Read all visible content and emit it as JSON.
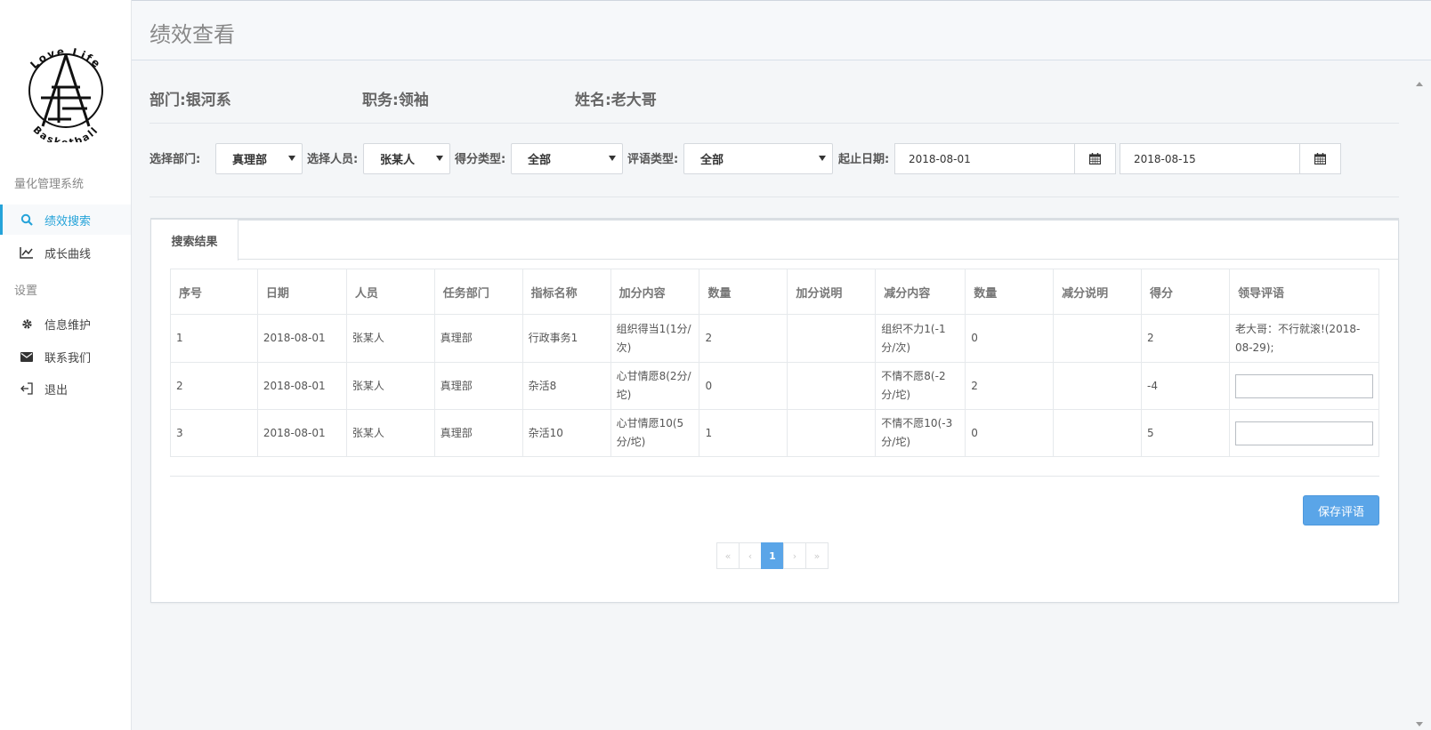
{
  "logo": {
    "top_text": "Love Life",
    "bottom_text": "Basketball"
  },
  "sidebar": {
    "section1": "量化管理系统",
    "items1": [
      {
        "label": "绩效搜索",
        "icon": "search-icon",
        "active": true
      },
      {
        "label": "成长曲线",
        "icon": "line-chart-icon"
      }
    ],
    "section2": "设置",
    "items2": [
      {
        "label": "信息维护",
        "icon": "gear-icon"
      },
      {
        "label": "联系我们",
        "icon": "envelope-icon"
      },
      {
        "label": "退出",
        "icon": "sign-out-icon"
      }
    ]
  },
  "header": {
    "title": "绩效查看"
  },
  "info": {
    "department": "部门:银河系",
    "position": "职务:领袖",
    "name": "姓名:老大哥"
  },
  "filters": {
    "dept_label": "选择部门:",
    "dept_value": "真理部",
    "person_label": "选择人员:",
    "person_value": "张某人",
    "score_type_label": "得分类型:",
    "score_type_value": "全部",
    "comment_type_label": "评语类型:",
    "comment_type_value": "全部",
    "date_label": "起止日期:",
    "start_date": "2018-08-01",
    "end_date": "2018-08-15"
  },
  "panel": {
    "tab": "搜索结果",
    "save_button": "保存评语"
  },
  "table": {
    "headers": [
      "序号",
      "日期",
      "人员",
      "任务部门",
      "指标名称",
      "加分内容",
      "数量",
      "加分说明",
      "减分内容",
      "数量",
      "减分说明",
      "得分",
      "领导评语"
    ],
    "rows": [
      [
        "1",
        "2018-08-01",
        "张某人",
        "真理部",
        "行政事务1",
        "组织得当1(1分/次)",
        "2",
        "",
        "组织不力1(-1分/次)",
        "0",
        "",
        "2",
        "老大哥：不行就滚!(2018-08-29);"
      ],
      [
        "2",
        "2018-08-01",
        "张某人",
        "真理部",
        "杂活8",
        "心甘情愿8(2分/坨)",
        "0",
        "",
        "不情不愿8(-2分/坨)",
        "2",
        "",
        "-4",
        ""
      ],
      [
        "3",
        "2018-08-01",
        "张某人",
        "真理部",
        "杂活10",
        "心甘情愿10(5分/坨)",
        "1",
        "",
        "不情不愿10(-3分/坨)",
        "0",
        "",
        "5",
        ""
      ]
    ]
  },
  "pagination": {
    "first": "«",
    "prev": "‹",
    "current": "1",
    "next": "›",
    "last": "»"
  },
  "colors": {
    "accent": "#25a3d9",
    "button": "#5aa5e8"
  }
}
